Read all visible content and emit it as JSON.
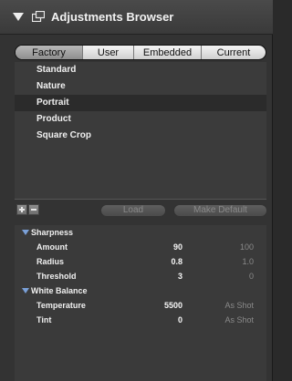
{
  "header": {
    "title": "Adjustments Browser",
    "icon": "window-icon"
  },
  "tabs": [
    {
      "label": "Factory",
      "active": true
    },
    {
      "label": "User",
      "active": false
    },
    {
      "label": "Embedded",
      "active": false
    },
    {
      "label": "Current",
      "active": false
    }
  ],
  "presets": [
    "Standard",
    "Nature",
    "Portrait",
    "Product",
    "Square Crop"
  ],
  "selected_preset": "Portrait",
  "toolbar": {
    "load_label": "Load",
    "default_label": "Make Default"
  },
  "groups": [
    {
      "name": "Sharpness",
      "rows": [
        {
          "name": "Amount",
          "value": "90",
          "default": "100"
        },
        {
          "name": "Radius",
          "value": "0.8",
          "default": "1.0"
        },
        {
          "name": "Threshold",
          "value": "3",
          "default": "0"
        }
      ]
    },
    {
      "name": "White Balance",
      "rows": [
        {
          "name": "Temperature",
          "value": "5500",
          "default": "As Shot"
        },
        {
          "name": "Tint",
          "value": "0",
          "default": "As Shot"
        }
      ]
    }
  ],
  "colors": {
    "disclosure_blue": "#7aa0d8",
    "panel": "#333333"
  }
}
